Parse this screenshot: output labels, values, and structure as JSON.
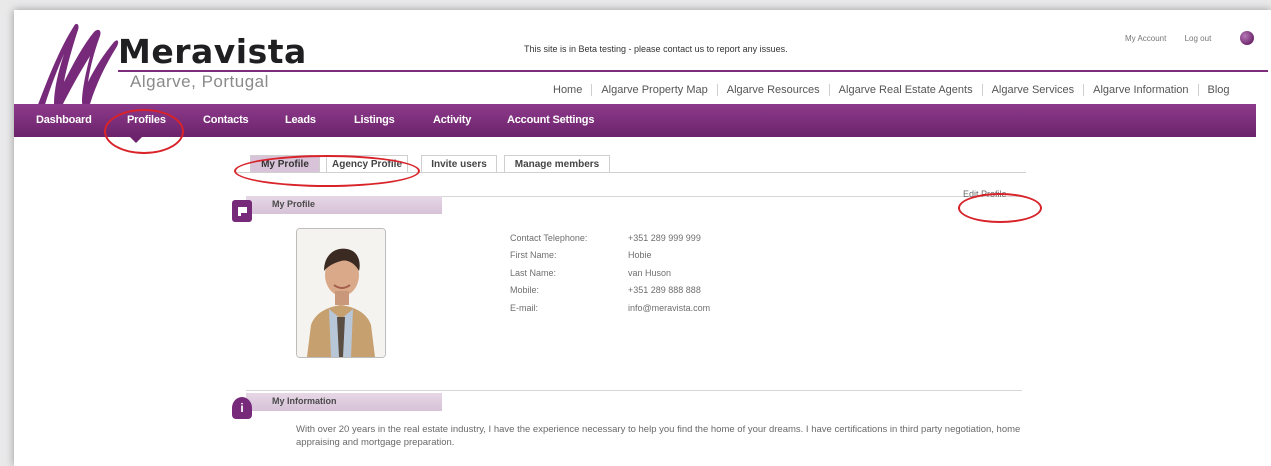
{
  "brand": {
    "name": "Meravista",
    "subtitle": "Algarve, Portugal",
    "colors": {
      "primary": "#77297a",
      "highlight": "#d8232a"
    }
  },
  "beta_notice": "This site is in Beta testing - please contact us to report any issues.",
  "top_links": {
    "account": "My Account",
    "logout": "Log out",
    "icon": "globe-icon"
  },
  "main_nav": [
    "Home",
    "Algarve Property Map",
    "Algarve Resources",
    "Algarve Real Estate Agents",
    "Algarve Services",
    "Algarve Information",
    "Blog"
  ],
  "dashboard_nav": [
    "Dashboard",
    "Profiles",
    "Contacts",
    "Leads",
    "Listings",
    "Activity",
    "Account Settings"
  ],
  "tabs": [
    "My Profile",
    "Agency Profile",
    "Invite users",
    "Manage members"
  ],
  "profile": {
    "section_title": "My Profile",
    "edit_label": "Edit Profile",
    "fields": [
      {
        "label": "Contact Telephone:",
        "value": "+351 289 999 999"
      },
      {
        "label": "First Name:",
        "value": "Hobie"
      },
      {
        "label": "Last Name:",
        "value": "van Huson"
      },
      {
        "label": "Mobile:",
        "value": "+351 289 888 888"
      },
      {
        "label": "E-mail:",
        "value": "info@meravista.com"
      }
    ]
  },
  "information": {
    "section_title": "My Information",
    "bio": "With over 20 years in the real estate industry, I have the experience necessary to help you find the home of your dreams. I have certifications in third party negotiation, home appraising and mortgage preparation."
  }
}
